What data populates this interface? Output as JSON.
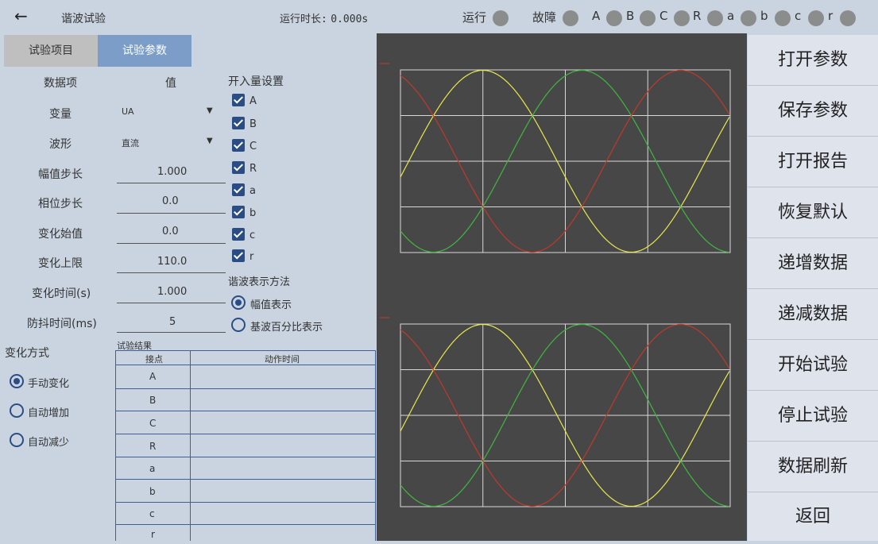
{
  "header": {
    "back_icon": "←",
    "title": "谐波试验",
    "runtime_label": "运行时长:",
    "runtime_value": "0.000s",
    "indicators": [
      {
        "label": "运行"
      },
      {
        "label": "故障"
      },
      {
        "label": "A"
      },
      {
        "label": "B"
      },
      {
        "label": "C"
      },
      {
        "label": "R"
      },
      {
        "label": "a"
      },
      {
        "label": "b"
      },
      {
        "label": "c"
      },
      {
        "label": "r"
      }
    ]
  },
  "tabs": [
    "试验项目",
    "试验参数"
  ],
  "params": {
    "head_item": "数据项",
    "head_value": "值",
    "rows": [
      {
        "label": "变量",
        "value": "UA"
      },
      {
        "label": "波形",
        "value": "直流"
      },
      {
        "label": "幅值步长",
        "value": "1.000"
      },
      {
        "label": "相位步长",
        "value": "0.0"
      },
      {
        "label": "变化始值",
        "value": "0.0"
      },
      {
        "label": "变化上限",
        "value": "110.0"
      },
      {
        "label": "变化时间(s)",
        "value": "1.000"
      },
      {
        "label": "防抖时间(ms)",
        "value": "5"
      }
    ]
  },
  "binary_inputs": {
    "title": "开入量设置",
    "items": [
      "A",
      "B",
      "C",
      "R",
      "a",
      "b",
      "c",
      "r"
    ]
  },
  "harmonic_method": {
    "title": "谐波表示方法",
    "options": [
      "幅值表示",
      "基波百分比表示"
    ],
    "selected": 0
  },
  "change_mode": {
    "title": "变化方式",
    "options": [
      "手动变化",
      "自动增加",
      "自动减少"
    ],
    "selected": 0
  },
  "results": {
    "title": "试验结果",
    "col_contact": "接点",
    "col_time": "动作时间",
    "rows": [
      "A",
      "B",
      "C",
      "R",
      "a",
      "b",
      "c",
      "r"
    ]
  },
  "colors": {
    "phase_a": "#e8e84a",
    "phase_b": "#3fb83f",
    "phase_c": "#c0392b"
  },
  "right_buttons": [
    "打开参数",
    "保存参数",
    "打开报告",
    "恢复默认",
    "递增数据",
    "递减数据",
    "开始试验",
    "停止试验",
    "数据刷新",
    "返回"
  ]
}
